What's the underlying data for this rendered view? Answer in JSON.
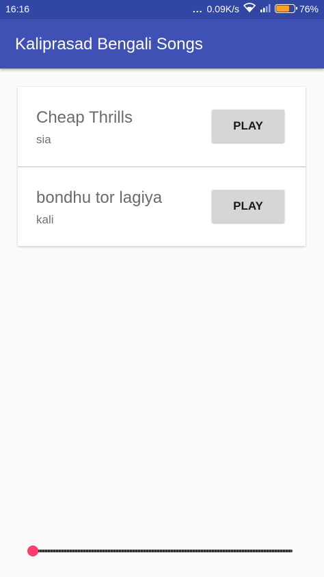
{
  "status_bar": {
    "time": "16:16",
    "dots": "...",
    "network_speed": "0.09K/s",
    "battery_percent": "76%",
    "battery_level": 0.76,
    "battery_color": "#f4a22b",
    "wifi_icon": "wifi-icon",
    "signal_icon": "signal-icon"
  },
  "app_bar": {
    "title": "Kaliprasad Bengali Songs",
    "color": "#3f51b5"
  },
  "songs": [
    {
      "title": "Cheap Thrills",
      "artist": "sia",
      "play_label": "PLAY"
    },
    {
      "title": "bondhu tor lagiya",
      "artist": "kali",
      "play_label": "PLAY"
    }
  ],
  "seekbar": {
    "progress": 0,
    "thumb_color": "#ff3d6e"
  }
}
